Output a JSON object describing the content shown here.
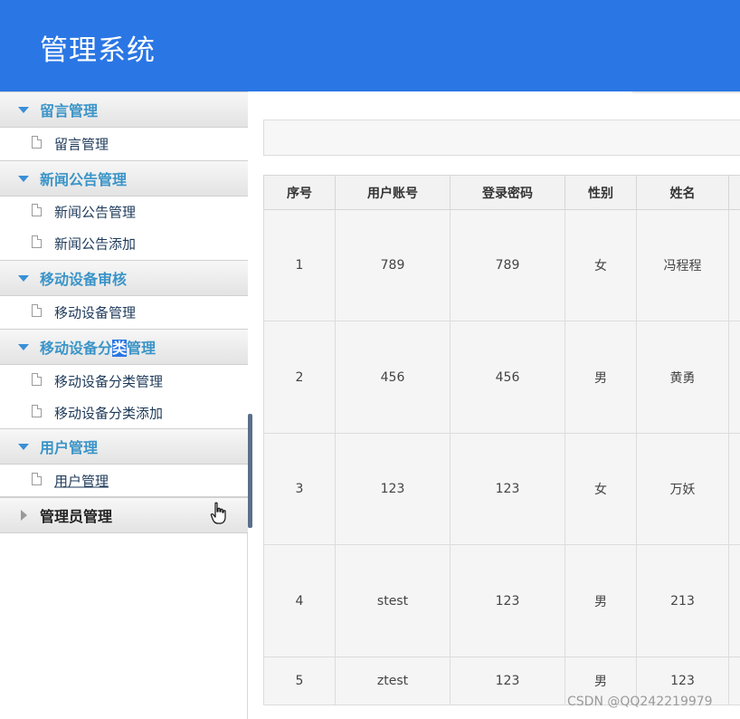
{
  "app": {
    "title": "管理系统"
  },
  "sidebar": {
    "groups": [
      {
        "label": "留言管理",
        "items": [
          {
            "label": "留言管理"
          }
        ]
      },
      {
        "label": "新闻公告管理",
        "items": [
          {
            "label": "新闻公告管理"
          },
          {
            "label": "新闻公告添加"
          }
        ]
      },
      {
        "label": "移动设备审核",
        "items": [
          {
            "label": "移动设备管理"
          }
        ]
      },
      {
        "label_before": "移动设备分",
        "label_highlight": "类",
        "label_after": "管理",
        "items": [
          {
            "label": "移动设备分类管理"
          },
          {
            "label": "移动设备分类添加"
          }
        ]
      },
      {
        "label": "用户管理",
        "items": [
          {
            "label": "用户管理"
          }
        ]
      },
      {
        "label": "管理员管理",
        "items": []
      }
    ]
  },
  "table": {
    "headers": [
      "序号",
      "用户账号",
      "登录密码",
      "性别",
      "姓名",
      ""
    ],
    "rows": [
      [
        "1",
        "789",
        "789",
        "女",
        "冯程程",
        ""
      ],
      [
        "2",
        "456",
        "456",
        "男",
        "黄勇",
        ""
      ],
      [
        "3",
        "123",
        "123",
        "女",
        "万妖",
        ""
      ],
      [
        "4",
        "stest",
        "123",
        "男",
        "213",
        ""
      ],
      [
        "5",
        "ztest",
        "123",
        "男",
        "123",
        ""
      ]
    ]
  },
  "watermark": "CSDN @QQ242219979",
  "colors": {
    "header": "#2a76e4",
    "group_label": "#3a94c8",
    "selection": "#2a76e4"
  },
  "icons": {
    "expanded": "caret-down-icon",
    "collapsed": "caret-right-icon",
    "item": "document-icon",
    "cursor": "hand-pointer-icon"
  }
}
